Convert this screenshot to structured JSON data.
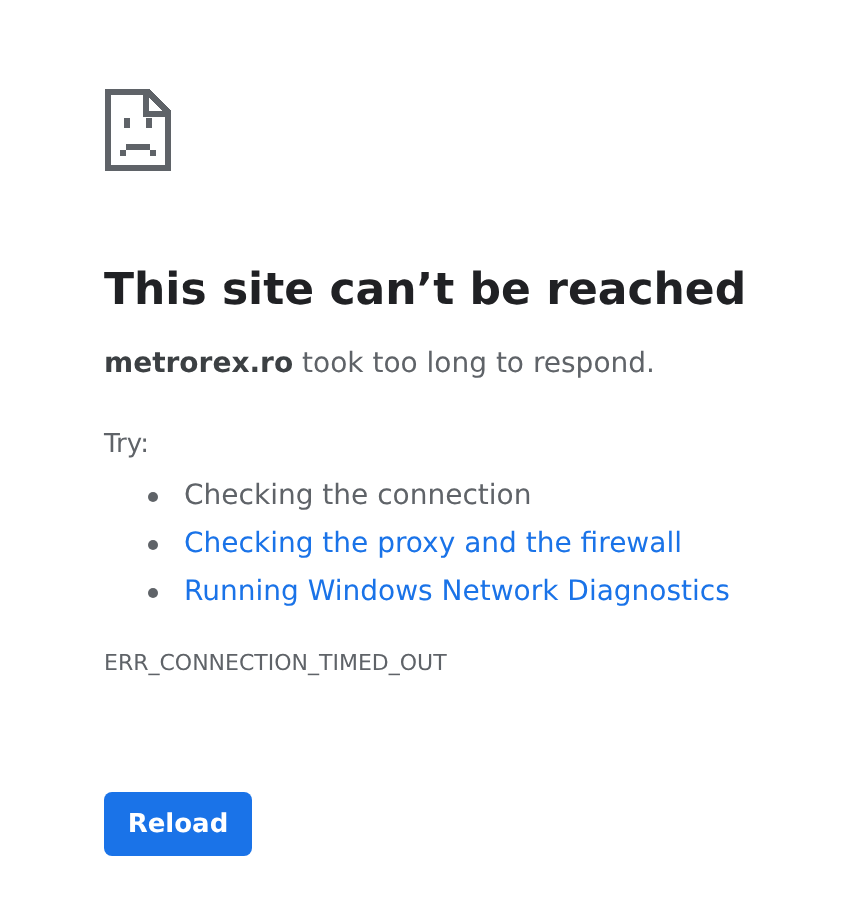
{
  "heading": "This site can’t be reached",
  "message": "**metrorex.ro** took too long to respond.",
  "try_label": "Try:",
  "suggestions": [
    {
      "kind": "text",
      "label": "Checking the connection"
    },
    {
      "kind": "link",
      "label": "Checking the proxy and the firewall"
    },
    {
      "kind": "link",
      "label": "Running Windows Network Diagnostics"
    }
  ],
  "error_code": "ERR_CONNECTION_TIMED_OUT",
  "button": "Reload"
}
